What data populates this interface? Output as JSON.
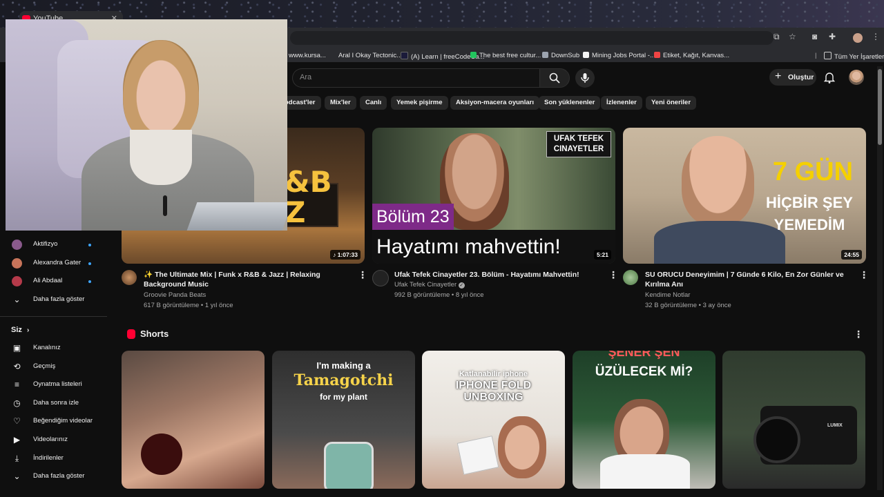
{
  "browser": {
    "tab_title": "YouTube",
    "bookmarks": [
      {
        "label": "www.kursa...",
        "color": "#ffffff"
      },
      {
        "label": "Aral I Okay Tectonic...",
        "color": "#3b82f6"
      },
      {
        "label": "(A) Learn | freeCodeCa...",
        "color": "#0a0a23"
      },
      {
        "label": "The best free cultur...",
        "color": "#22c55e"
      },
      {
        "label": "DownSub",
        "color": "#9ca3af"
      },
      {
        "label": "Mining Jobs Portal -...",
        "color": "#f5f5f5"
      },
      {
        "label": "Etiket, Kağıt, Kanvas...",
        "color": "#ef4444"
      }
    ],
    "all_bookmarks": "Tüm Yer İşaretleri"
  },
  "header": {
    "search_placeholder": "Ara",
    "create_label": "Oluştur"
  },
  "chips": [
    "odcast'ler",
    "Mix'ler",
    "Canlı",
    "Yemek pişirme",
    "Aksiyon-macera oyunları",
    "Son yüklenenler",
    "İzlenenler",
    "Yeni öneriler"
  ],
  "videos": [
    {
      "title": "✨ The Ultimate Mix | Funk x R&B & Jazz | Relaxing Background Music",
      "channel": "Groovie Panda Beats",
      "meta": "617 B görüntüleme • 1 yıl önce",
      "duration": "1:07:33",
      "thumb_text_1": "&B",
      "thumb_text_2": "Z",
      "accent": "#c98a3a"
    },
    {
      "title": "Ufak Tefek Cinayetler 23. Bölüm - Hayatımı Mahvettin!",
      "channel": "Ufak Tefek Cinayetler",
      "meta": "992 B görüntüleme • 8 yıl önce",
      "duration": "5:21",
      "thumb_brand_1": "UFAK TEFEK",
      "thumb_brand_2": "CINAYETLER",
      "thumb_episode": "Bölüm 23",
      "thumb_caption": "Hayatımı mahvettin!",
      "accent": "#7e2a88"
    },
    {
      "title": "SU ORUCU Deneyimim | 7 Günde 6 Kilo, En Zor Günler ve Kırılma Anı",
      "channel": "Kendime Notlar",
      "meta": "32 B görüntüleme • 3 ay önce",
      "duration": "24:55",
      "thumb_line_1": "7 GÜN",
      "thumb_line_2": "HİÇBİR ŞEY",
      "thumb_line_3": "YEMEDİM",
      "accent": "#f5d000"
    }
  ],
  "sidebar": {
    "subscriptions": [
      {
        "label": "Aktifizyo",
        "color": "#8a5a8c"
      },
      {
        "label": "Alexandra Gater",
        "color": "#c7745a"
      },
      {
        "label": "Ali Abdaal",
        "color": "#b53a4a"
      }
    ],
    "show_more_1": "Daha fazla göster",
    "you_heading": "Siz",
    "you_items": [
      {
        "label": "Kanalınız",
        "icon": "channel-icon",
        "glyph": "▣"
      },
      {
        "label": "Geçmiş",
        "icon": "history-icon",
        "glyph": "⟲"
      },
      {
        "label": "Oynatma listeleri",
        "icon": "playlists-icon",
        "glyph": "≡"
      },
      {
        "label": "Daha sonra izle",
        "icon": "watch-later-icon",
        "glyph": "◷"
      },
      {
        "label": "Beğendiğim videolar",
        "icon": "like-icon",
        "glyph": "👍"
      },
      {
        "label": "Videolarınız",
        "icon": "your-videos-icon",
        "glyph": "▶"
      },
      {
        "label": "İndirilenler",
        "icon": "downloads-icon",
        "glyph": "⤓"
      }
    ],
    "show_more_2": "Daha fazla göster"
  },
  "shorts": {
    "heading": "Shorts",
    "items": [
      {
        "caption": "",
        "bg": "#7a5a4a"
      },
      {
        "caption_1": "I'm making a",
        "caption_2": "Tamagotchi",
        "caption_3": "for my plant",
        "bg": "#3a3a3a"
      },
      {
        "caption_1": "Katlanabilir iphone",
        "caption_2": "IPHONE FOLD",
        "caption_3": "UNBOXING",
        "bg": "#e9e6e1"
      },
      {
        "caption_1": "ŞENER ŞEN",
        "caption_2": "ÜZÜLECEK Mİ?",
        "bg": "#1f4a2c"
      },
      {
        "caption": "LUMIX",
        "bg": "#2b3a2c"
      }
    ]
  }
}
